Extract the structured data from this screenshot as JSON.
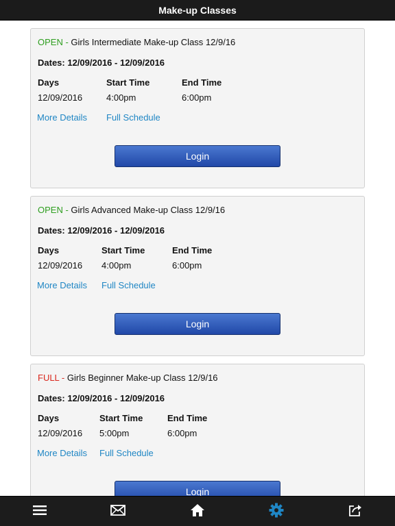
{
  "header": {
    "title": "Make-up Classes"
  },
  "classes": [
    {
      "status": "OPEN",
      "separator": " - ",
      "name": "Girls Intermediate Make-up Class 12/9/16",
      "dates": "Dates: 12/09/2016 - 12/09/2016",
      "days_label": "Days",
      "start_label": "Start Time",
      "end_label": "End Time",
      "days": "12/09/2016",
      "start": "4:00pm",
      "end": "6:00pm",
      "more_details": "More Details",
      "full_schedule": "Full Schedule",
      "login": "Login"
    },
    {
      "status": "OPEN",
      "separator": " - ",
      "name": "Girls Advanced Make-up Class 12/9/16",
      "dates": "Dates: 12/09/2016 - 12/09/2016",
      "days_label": "Days",
      "start_label": "Start Time",
      "end_label": "End Time",
      "days": "12/09/2016",
      "start": "4:00pm",
      "end": "6:00pm",
      "more_details": "More Details",
      "full_schedule": "Full Schedule",
      "login": "Login"
    },
    {
      "status": "FULL",
      "separator": " - ",
      "name": "Girls Beginner Make-up Class 12/9/16",
      "dates": "Dates: 12/09/2016 - 12/09/2016",
      "days_label": "Days",
      "start_label": "Start Time",
      "end_label": "End Time",
      "days": "12/09/2016",
      "start": "5:00pm",
      "end": "6:00pm",
      "more_details": "More Details",
      "full_schedule": "Full Schedule",
      "login": "Login"
    }
  ],
  "colors": {
    "open": "#2e9e1f",
    "full": "#d9261c",
    "link": "#1f86c4",
    "active_tab": "#1f86c4",
    "button": "#2b55b5"
  },
  "tabbar": {
    "items": [
      {
        "icon": "menu-icon"
      },
      {
        "icon": "mail-icon"
      },
      {
        "icon": "home-icon"
      },
      {
        "icon": "gear-icon",
        "active": true
      },
      {
        "icon": "share-icon"
      }
    ]
  }
}
